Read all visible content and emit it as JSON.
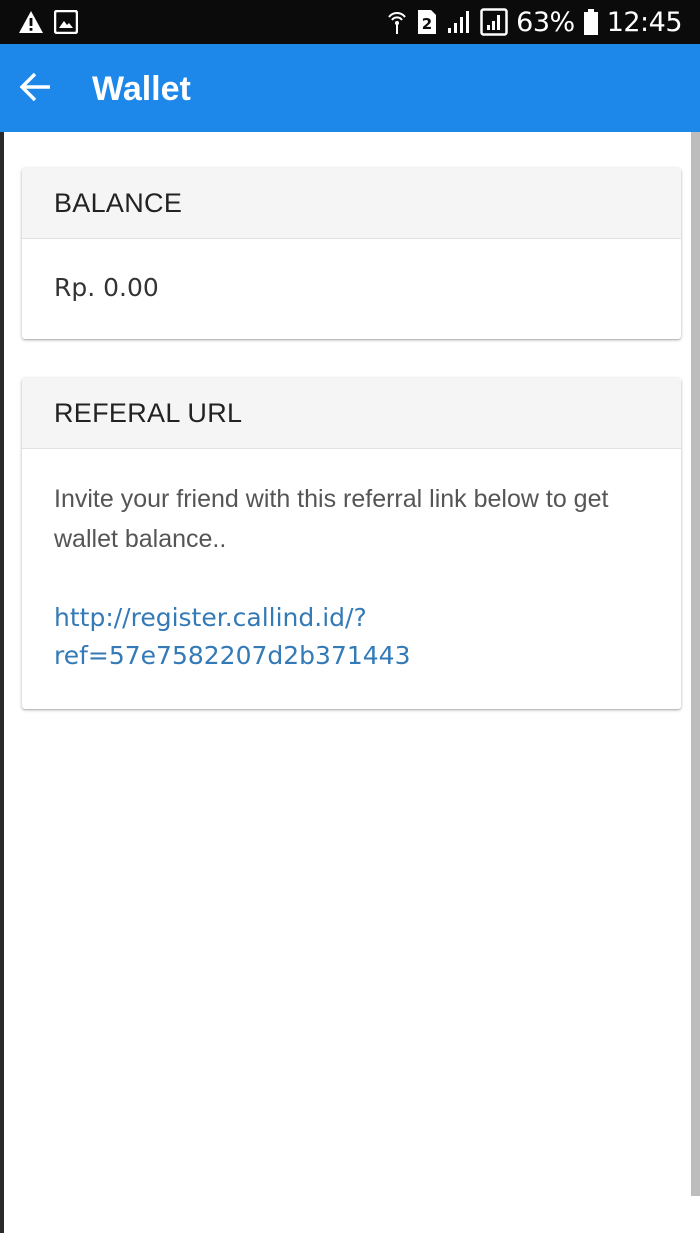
{
  "status_bar": {
    "battery": "63%",
    "time": "12:45",
    "sim_badge": "2",
    "icons": [
      "warning-icon",
      "image-icon",
      "hotspot-icon",
      "sim-icon",
      "signal-icon",
      "signal-box-icon",
      "battery-icon"
    ]
  },
  "app_bar": {
    "title": "Wallet",
    "back_icon": "arrow-left-icon",
    "color": "#1e88ea"
  },
  "balance_card": {
    "header": "BALANCE",
    "value": "Rp. 0.00"
  },
  "referral_card": {
    "header": "REFERAL URL",
    "description": "Invite your friend with this referral link below to get wallet balance..",
    "link_line1": "http://register.callind.id/?",
    "link_line2": "ref=57e7582207d2b371443",
    "link_color": "#337ab7"
  }
}
